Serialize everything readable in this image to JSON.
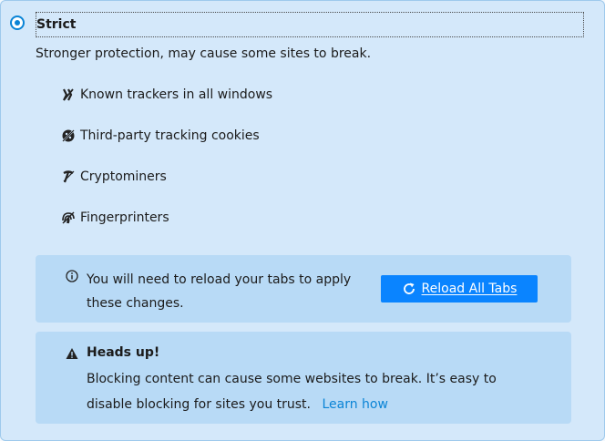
{
  "option": {
    "label": "Strict",
    "selected": true,
    "description": "Stronger protection, may cause some sites to break."
  },
  "features": [
    {
      "label": "Known trackers in all windows",
      "icon": "tracker-icon"
    },
    {
      "label": "Third-party tracking cookies",
      "icon": "cookie-icon"
    },
    {
      "label": "Cryptominers",
      "icon": "cryptominer-icon"
    },
    {
      "label": "Fingerprinters",
      "icon": "fingerprint-icon"
    }
  ],
  "reload_notice": {
    "text": "You will need to reload your tabs to apply these changes.",
    "button_label": "Reload All Tabs"
  },
  "warning": {
    "title": "Heads up!",
    "text": "Blocking content can cause some websites to break. It’s easy to disable blocking for sites you trust.",
    "link_label": "Learn how"
  },
  "colors": {
    "panel_bg": "#d4e8fa",
    "box_bg": "#b8daf6",
    "button_bg": "#0a84ff",
    "link": "#0a84d6"
  }
}
